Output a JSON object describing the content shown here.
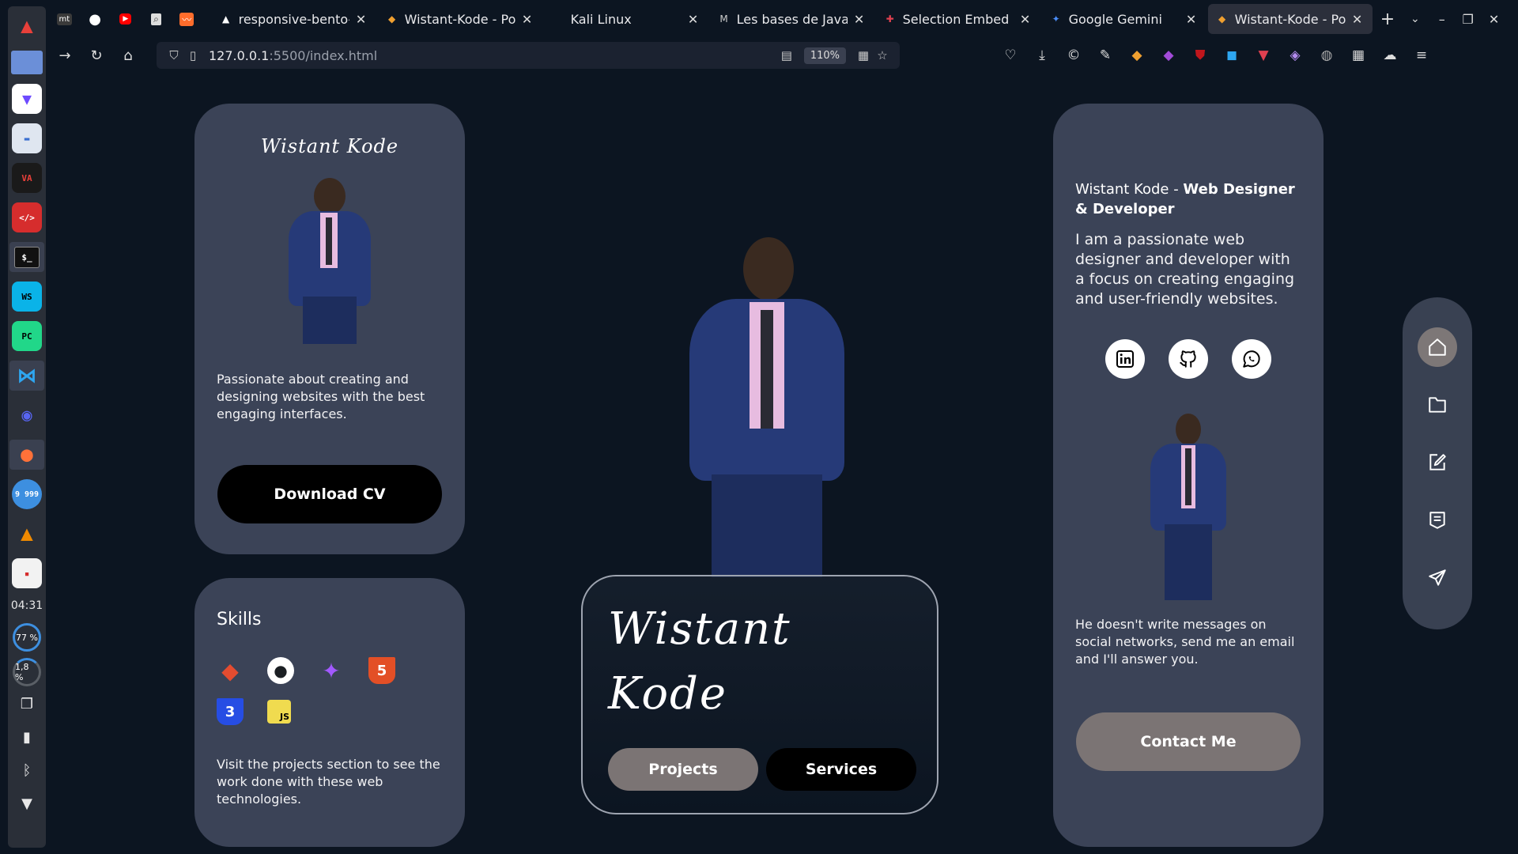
{
  "dock": {
    "clock": "04:31",
    "memory_meter": "77 %",
    "cpu_meter": "1,8 %",
    "badge_count": "9 999"
  },
  "browser": {
    "pinned_tabs": [
      "mt",
      "github",
      "youtube",
      "search",
      "analytics"
    ],
    "tabs": [
      {
        "title": "responsive-bento-portfolio",
        "active": false
      },
      {
        "title": "Wistant-Kode - Portfolio",
        "active": false
      },
      {
        "title": "Kali Linux",
        "active": false
      },
      {
        "title": "Les bases de JavaScript",
        "active": false
      },
      {
        "title": "Selection Embed Code",
        "active": false
      },
      {
        "title": "Google Gemini",
        "active": false
      },
      {
        "title": "Wistant-Kode - Portfolio",
        "active": true
      }
    ],
    "url_host": "127.0.0.1",
    "url_rest": ":5500/index.html",
    "zoom": "110%"
  },
  "profile_card": {
    "signature": "Wistant Kode",
    "description": "Passionate about creating and designing websites with the best engaging interfaces.",
    "download_label": "Download CV"
  },
  "skills_card": {
    "title": "Skills",
    "skills": [
      {
        "name": "git",
        "label": "◆",
        "color": "#e44c30"
      },
      {
        "name": "github",
        "label": "●",
        "color": "#1b1f23"
      },
      {
        "name": "figma",
        "label": "✦",
        "color": "#a259ff"
      },
      {
        "name": "html5",
        "label": "5",
        "color": "#e34f26"
      },
      {
        "name": "css3",
        "label": "3",
        "color": "#264de4"
      },
      {
        "name": "javascript",
        "label": "JS",
        "color": "#f0db4f"
      }
    ],
    "description": "Visit the projects section to see the work done with these web technologies."
  },
  "hero": {
    "name_line1": "Wistant",
    "name_line2": "Kode",
    "projects_label": "Projects",
    "services_label": "Services"
  },
  "about_card": {
    "name": "Wistant Kode - ",
    "role": "Web Designer & Developer",
    "bio": "I am a passionate web designer and developer with a focus on creating engaging and user-friendly websites.",
    "socials": [
      "linkedin",
      "github",
      "whatsapp"
    ],
    "note": "He doesn't write messages on social networks, send me an email and I'll answer you.",
    "contact_label": "Contact Me"
  },
  "sidenav": {
    "items": [
      "home",
      "projects",
      "services",
      "resume",
      "contact"
    ],
    "active": "home"
  },
  "colors": {
    "page_bg": "#0c1521",
    "card_bg": "#3b4357",
    "button_grey": "#7b7474",
    "button_black": "#000000"
  }
}
